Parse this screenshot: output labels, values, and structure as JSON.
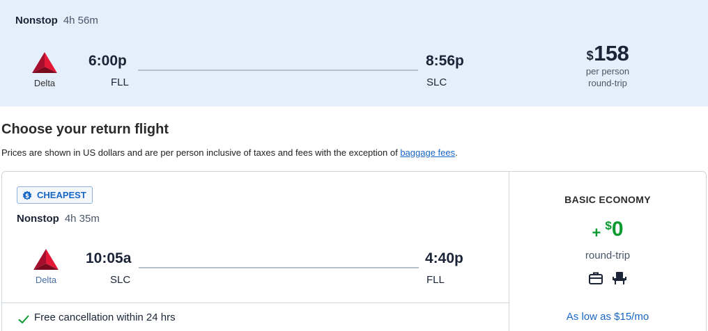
{
  "outbound": {
    "stops": "Nonstop",
    "duration": "4h 56m",
    "airline": "Delta",
    "depart_time": "6:00p",
    "depart_code": "FLL",
    "arrive_time": "8:56p",
    "arrive_code": "SLC",
    "price_currency": "$",
    "price_amount": "158",
    "price_per": "per person",
    "price_trip": "round-trip"
  },
  "section": {
    "title": "Choose your return flight",
    "disclaimer_text": "Prices are shown in US dollars and are per person inclusive of taxes and fees with the exception of ",
    "disclaimer_link": "baggage fees",
    "disclaimer_end": "."
  },
  "return_flight": {
    "badge": "CHEAPEST",
    "stops": "Nonstop",
    "duration": "4h 35m",
    "airline": "Delta",
    "depart_time": "10:05a",
    "depart_code": "SLC",
    "arrive_time": "4:40p",
    "arrive_code": "FLL",
    "cancellation": "Free cancellation within 24 hrs",
    "fare": {
      "name": "BASIC ECONOMY",
      "plus": "+",
      "currency": "$",
      "amount": "0",
      "trip": "round-trip",
      "icons": [
        "personal-bag-icon",
        "seat-icon"
      ],
      "installment": "As low as $15/mo"
    }
  },
  "colors": {
    "banner_bg": "#e4effb",
    "link": "#1766c6",
    "green": "#0a9a2f",
    "delta_red": "#c8102e"
  }
}
